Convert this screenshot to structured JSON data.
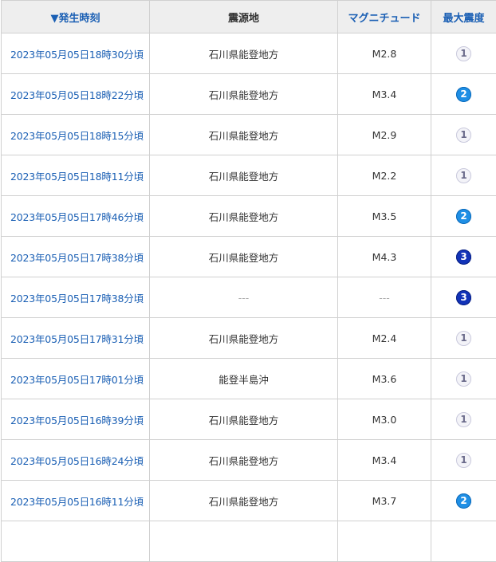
{
  "headers": {
    "time": "▼発生時刻",
    "epicenter": "震源地",
    "magnitude": "マグニチュード",
    "max_intensity": "最大震度"
  },
  "rows": [
    {
      "time": "2023年05月05日18時30分頃",
      "epicenter": "石川県能登地方",
      "magnitude": "M2.8",
      "intensity": "1"
    },
    {
      "time": "2023年05月05日18時22分頃",
      "epicenter": "石川県能登地方",
      "magnitude": "M3.4",
      "intensity": "2"
    },
    {
      "time": "2023年05月05日18時15分頃",
      "epicenter": "石川県能登地方",
      "magnitude": "M2.9",
      "intensity": "1"
    },
    {
      "time": "2023年05月05日18時11分頃",
      "epicenter": "石川県能登地方",
      "magnitude": "M2.2",
      "intensity": "1"
    },
    {
      "time": "2023年05月05日17時46分頃",
      "epicenter": "石川県能登地方",
      "magnitude": "M3.5",
      "intensity": "2"
    },
    {
      "time": "2023年05月05日17時38分頃",
      "epicenter": "石川県能登地方",
      "magnitude": "M4.3",
      "intensity": "3"
    },
    {
      "time": "2023年05月05日17時38分頃",
      "epicenter": "---",
      "magnitude": "---",
      "intensity": "3"
    },
    {
      "time": "2023年05月05日17時31分頃",
      "epicenter": "石川県能登地方",
      "magnitude": "M2.4",
      "intensity": "1"
    },
    {
      "time": "2023年05月05日17時01分頃",
      "epicenter": "能登半島沖",
      "magnitude": "M3.6",
      "intensity": "1"
    },
    {
      "time": "2023年05月05日16時39分頃",
      "epicenter": "石川県能登地方",
      "magnitude": "M3.0",
      "intensity": "1"
    },
    {
      "time": "2023年05月05日16時24分頃",
      "epicenter": "石川県能登地方",
      "magnitude": "M3.4",
      "intensity": "1"
    },
    {
      "time": "2023年05月05日16時11分頃",
      "epicenter": "石川県能登地方",
      "magnitude": "M3.7",
      "intensity": "2"
    }
  ],
  "colors": {
    "link": "#1a5fb4",
    "header_bg": "#eeeeee",
    "border": "#d0d0d0",
    "intensity_1": "#f3f3f8",
    "intensity_2": "#1f8fe5",
    "intensity_3": "#1233b8"
  }
}
